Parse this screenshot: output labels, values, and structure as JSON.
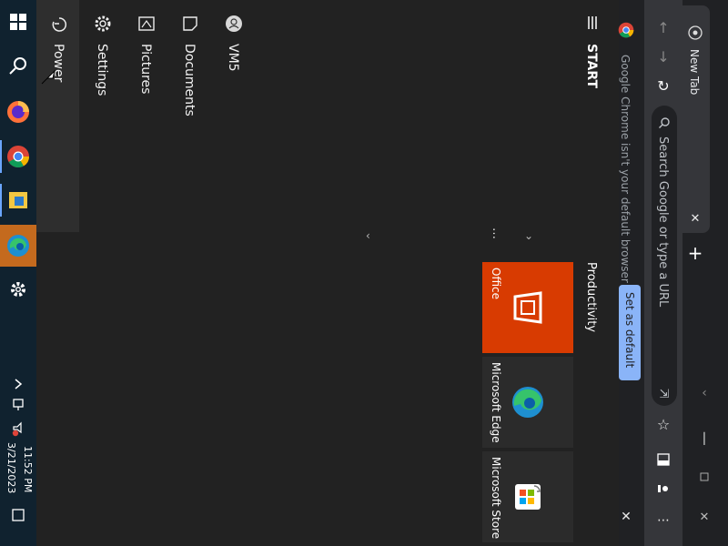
{
  "start_menu": {
    "header": "START",
    "user_name": "VM5",
    "items": [
      {
        "label": "Documents",
        "icon": "document-icon"
      },
      {
        "label": "Pictures",
        "icon": "picture-icon"
      },
      {
        "label": "Settings",
        "icon": "gear-icon"
      },
      {
        "label": "Power",
        "icon": "power-icon"
      }
    ],
    "tiles_group": "Productivity",
    "tiles": [
      {
        "label": "Office",
        "color": "#d83b01"
      },
      {
        "label": "Microsoft Edge",
        "color": "#2b2b2b"
      },
      {
        "label": "Microsoft Store",
        "color": "#2b2b2b"
      }
    ],
    "ellipsis": "…"
  },
  "chrome": {
    "tab_title": "New Tab",
    "omnibox_placeholder": "Search Google or type a URL",
    "banner_text": "Google Chrome isn't your default browser",
    "banner_button": "Set as default"
  },
  "taskbar": {
    "time": "11:52 PM",
    "date": "3/21/2023"
  },
  "colors": {
    "accent_orange": "#c46a1e",
    "office_red": "#d83b01",
    "chrome_blue": "#8ab4f8"
  }
}
